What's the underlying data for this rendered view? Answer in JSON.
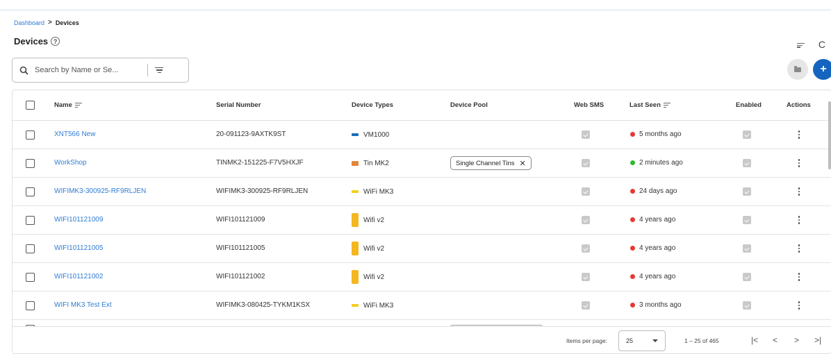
{
  "breadcrumb": {
    "parent": "Dashboard",
    "separator": ">",
    "current": "Devices"
  },
  "page": {
    "title": "Devices",
    "help_glyph": "?"
  },
  "toolbar": {
    "sort_icon": "sort-icon",
    "refresh_icon": "refresh-icon",
    "refresh_glyph": "C"
  },
  "search": {
    "placeholder": "Search by Name or Se...",
    "value": ""
  },
  "fab": {
    "add_glyph": "+"
  },
  "table": {
    "headers": {
      "name": "Name",
      "serial": "Serial Number",
      "types": "Device Types",
      "pool": "Device Pool",
      "websms": "Web SMS",
      "lastseen": "Last Seen",
      "enabled": "Enabled",
      "actions": "Actions"
    },
    "rows": [
      {
        "name": "XNT566 New",
        "serial": "20-091123-9AXTK9ST",
        "type": "VM1000",
        "type_icon": "vm",
        "pool": "",
        "last_seen": "5 months ago",
        "status": "red"
      },
      {
        "name": "WorkShop",
        "serial": "TINMK2-151225-F7V5HXJF",
        "type": "Tin MK2",
        "type_icon": "tin",
        "pool": "Single Channel Tins",
        "last_seen": "2 minutes ago",
        "status": "green"
      },
      {
        "name": "WIFIMK3-300925-RF9RLJEN",
        "serial": "WIFIMK3-300925-RF9RLJEN",
        "type": "WiFi MK3",
        "type_icon": "mk3",
        "pool": "",
        "last_seen": "24 days ago",
        "status": "red"
      },
      {
        "name": "WIFI101121009",
        "serial": "WIFI101121009",
        "type": "Wifi v2",
        "type_icon": "wifi",
        "pool": "",
        "last_seen": "4 years ago",
        "status": "red"
      },
      {
        "name": "WIFI101121005",
        "serial": "WIFI101121005",
        "type": "Wifi v2",
        "type_icon": "wifi",
        "pool": "",
        "last_seen": "4 years ago",
        "status": "red"
      },
      {
        "name": "WIFI101121002",
        "serial": "WIFI101121002",
        "type": "Wifi v2",
        "type_icon": "wifi",
        "pool": "",
        "last_seen": "4 years ago",
        "status": "red"
      },
      {
        "name": "WIFI MK3 Test Ext",
        "serial": "WIFIMK3-080425-TYKM1KSX",
        "type": "WiFi MK3",
        "type_icon": "mk3",
        "pool": "",
        "last_seen": "3 months ago",
        "status": "red"
      }
    ]
  },
  "pagination": {
    "items_per_page_label": "Items per page:",
    "items_per_page": "25",
    "range": "1 – 25 of 465",
    "first": "|<",
    "prev": "<",
    "next": ">",
    "last": ">|"
  },
  "colors": {
    "link": "#2f7cd3",
    "status_red": "#e53935",
    "status_green": "#2eb82e",
    "primary": "#1565c0"
  }
}
